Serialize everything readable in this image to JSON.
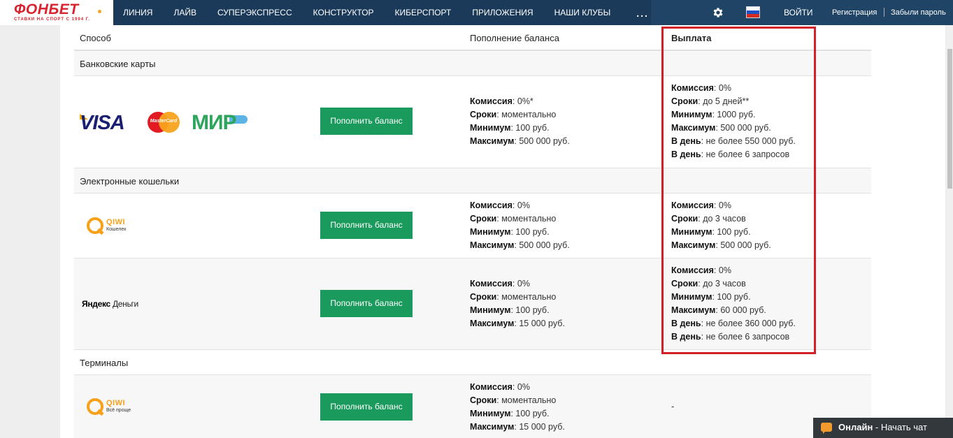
{
  "logo": {
    "brand": "ФОНБЕТ",
    "tagline": "СТАВКИ НА СПОРТ С 1994 Г."
  },
  "nav": {
    "items": [
      "ЛИНИЯ",
      "ЛАЙВ",
      "СУПЕРЭКСПРЕСС",
      "КОНСТРУКТОР",
      "КИБЕРСПОРТ",
      "ПРИЛОЖЕНИЯ",
      "НАШИ КЛУБЫ"
    ],
    "more": "..."
  },
  "header_right": {
    "login": "ВОЙТИ",
    "register": "Регистрация",
    "forgot": "Забыли пароль",
    "settings_icon": "gear-icon",
    "flag_icon": "russia-flag-icon"
  },
  "table": {
    "headers": {
      "method": "Способ",
      "deposit": "Пополнение баланса",
      "payout": "Выплата"
    },
    "sections": {
      "cards": "Банковские карты",
      "ewallets": "Электронные кошельки",
      "terminals": "Терминалы"
    },
    "button_label": "Пополнить баланс",
    "logos": {
      "visa": "VISA",
      "mastercard": "MasterCard",
      "mir": "МИР",
      "qiwi": "QIWI",
      "qiwi_wallet_sub": "Кошелек",
      "qiwi_terminal_sub": "Всё проще",
      "yandex_1": "Яндекс",
      "yandex_2": "Деньги"
    },
    "labels": {
      "commission": "Комиссия",
      "terms": "Сроки",
      "minimum": "Минимум",
      "maximum": "Максимум",
      "per_day": "В день"
    },
    "rows": {
      "cards": {
        "deposit": {
          "commission": ": 0%*",
          "terms": ": моментально",
          "minimum": ": 100 руб.",
          "maximum": ": 500 000 руб."
        },
        "payout": {
          "commission": ": 0%",
          "terms": ": до 5 дней**",
          "minimum": ": 1000 руб.",
          "maximum": ": 500 000 руб.",
          "per_day_1": ": не более 550 000 руб.",
          "per_day_2": ": не более 6 запросов"
        }
      },
      "qiwi": {
        "deposit": {
          "commission": ": 0%",
          "terms": ": моментально",
          "minimum": ": 100 руб.",
          "maximum": ": 500 000 руб."
        },
        "payout": {
          "commission": ": 0%",
          "terms": ": до 3 часов",
          "minimum": ": 100 руб.",
          "maximum": ": 500 000 руб."
        }
      },
      "yandex": {
        "deposit": {
          "commission": ": 0%",
          "terms": ": моментально",
          "minimum": ": 100 руб.",
          "maximum": ": 15 000 руб."
        },
        "payout": {
          "commission": ": 0%",
          "terms": ": до 3 часов",
          "minimum": ": 100 руб.",
          "maximum": ": 60 000 руб.",
          "per_day_1": ": не более 360 000 руб.",
          "per_day_2": ": не более 6 запросов"
        }
      },
      "terminal": {
        "deposit": {
          "commission": ": 0%",
          "terms": ": моментально",
          "minimum": ": 100 руб.",
          "maximum": ": 15 000 руб."
        },
        "payout": "-"
      }
    }
  },
  "chat": {
    "status": "Онлайн",
    "action": " - Начать чат"
  },
  "colors": {
    "brand_red": "#d9232e",
    "nav_bg": "#1b3a5a",
    "button_green": "#1a9a5c",
    "highlight_red": "#d32028"
  }
}
